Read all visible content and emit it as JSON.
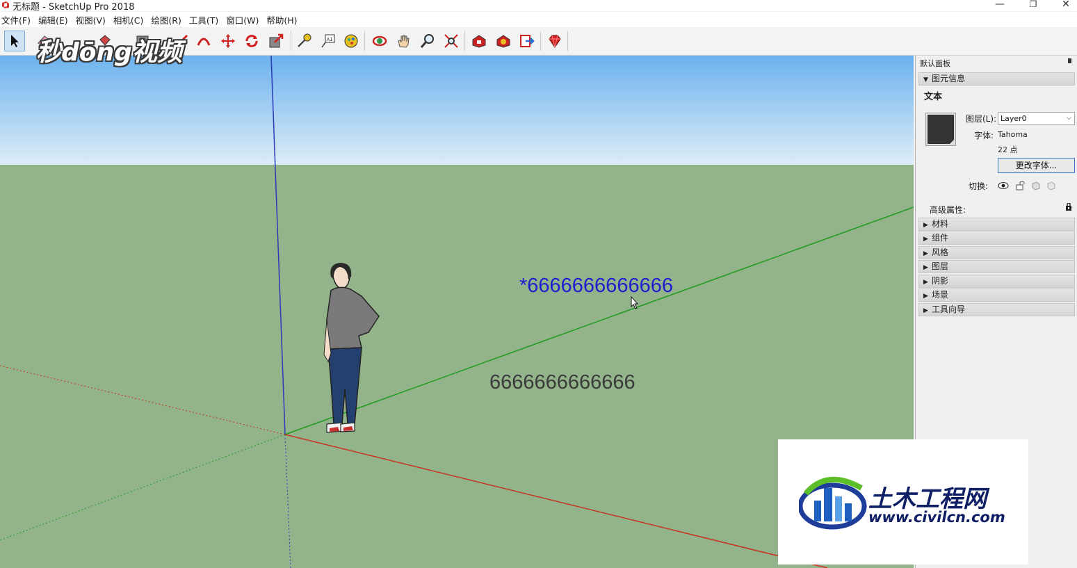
{
  "window": {
    "title": "无标题 - SketchUp Pro 2018",
    "minimize": "—",
    "restore": "❐",
    "close": "✕"
  },
  "menu": [
    "文件(F)",
    "编辑(E)",
    "视图(V)",
    "相机(C)",
    "绘图(R)",
    "工具(T)",
    "窗口(W)",
    "帮助(H)"
  ],
  "toolbar": {
    "icons": [
      "select-icon",
      "eraser-icon",
      "paint-bucket-icon",
      "rectangle-icon",
      "line-icon",
      "arc-icon",
      "move-icon",
      "rotate-icon",
      "scale-icon",
      "tape-measure-icon",
      "text-icon",
      "paint-icon",
      "orbit-icon",
      "pan-icon",
      "zoom-icon",
      "zoom-extents-icon",
      "warehouse-icon",
      "extension-warehouse-icon",
      "send-to-layout-icon",
      "extension-manager-icon"
    ]
  },
  "watermark_top": "秒dōng视频",
  "viewport": {
    "sky_top": "#6cb2ee",
    "sky_bottom": "#dcecf6",
    "ground": "#93b48b",
    "text_selected": "*6666666666666",
    "text_normal": "6666666666666"
  },
  "panel": {
    "title": "默认面板",
    "entity_info": {
      "header": "图元信息",
      "type": "文本",
      "layer_label": "图层(L):",
      "layer_value": "Layer0",
      "font_label": "字体:",
      "font_value": "Tahoma",
      "size_value": "22 点",
      "change_font_button": "更改字体...",
      "toggle_label": "切换:",
      "advanced_label": "高级属性:"
    },
    "sections": [
      "材料",
      "组件",
      "风格",
      "图层",
      "阴影",
      "场景",
      "工具向导"
    ]
  },
  "watermark_bottom": {
    "name": "土木工程网",
    "url": "www.civilcn.com"
  }
}
